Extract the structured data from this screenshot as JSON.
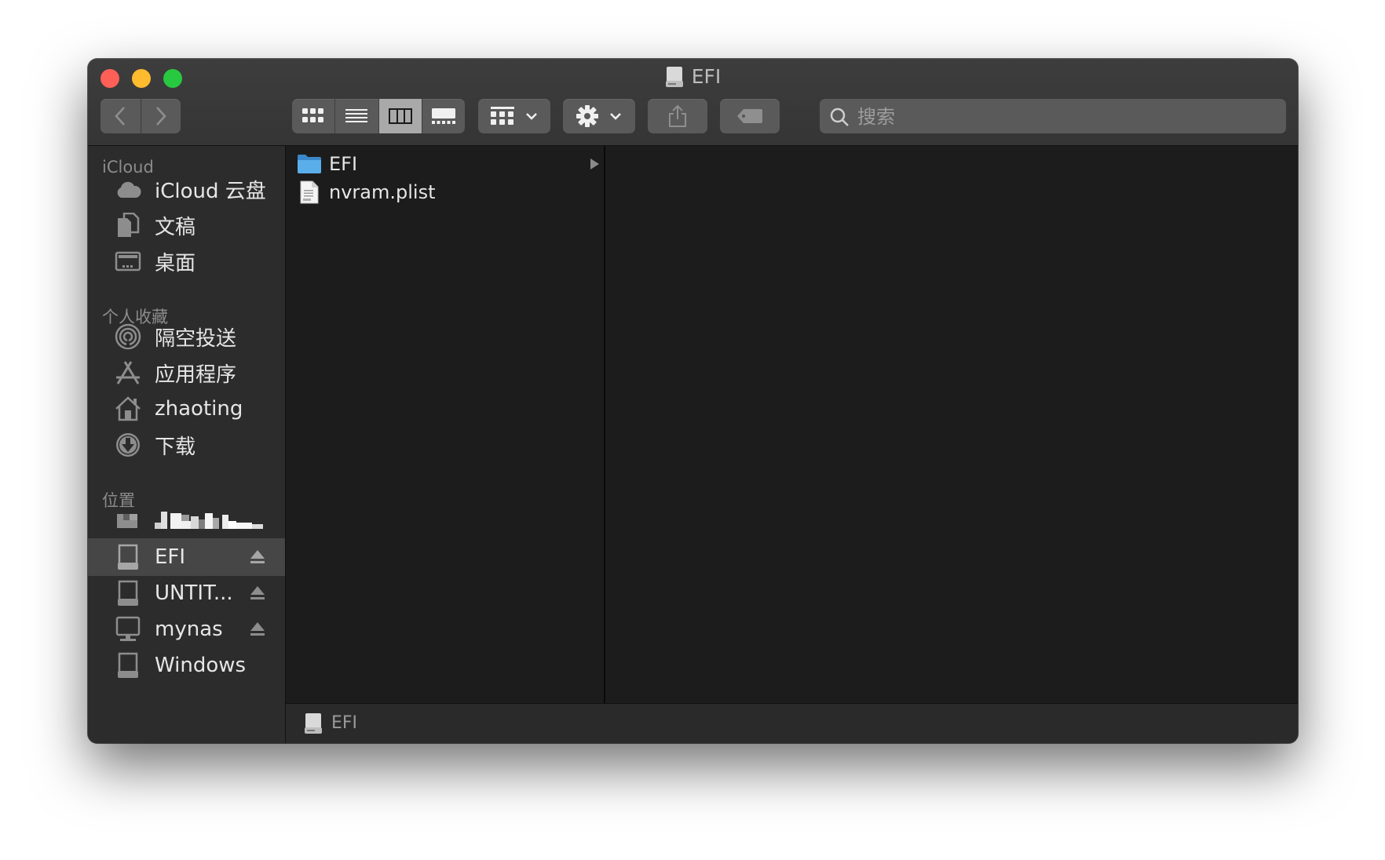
{
  "window": {
    "title": "EFI"
  },
  "toolbar": {
    "search_placeholder": "搜索",
    "active_view": "column"
  },
  "sidebar": {
    "sections": [
      {
        "header": "iCloud",
        "items": [
          {
            "label": "iCloud 云盘",
            "icon": "cloud-icon"
          },
          {
            "label": "文稿",
            "icon": "document-icon"
          },
          {
            "label": "桌面",
            "icon": "desktop-icon"
          }
        ]
      },
      {
        "header": "个人收藏",
        "items": [
          {
            "label": "隔空投送",
            "icon": "airdrop-icon"
          },
          {
            "label": "应用程序",
            "icon": "applications-icon"
          },
          {
            "label": "zhaoting",
            "icon": "home-icon"
          },
          {
            "label": "下载",
            "icon": "download-icon"
          }
        ]
      },
      {
        "header": "位置",
        "items": [
          {
            "label": "",
            "icon": "computer-icon",
            "redacted": true
          },
          {
            "label": "EFI",
            "icon": "drive-icon",
            "eject": true,
            "selected": true
          },
          {
            "label": "UNTIT...",
            "icon": "drive-icon",
            "eject": true
          },
          {
            "label": "mynas",
            "icon": "network-drive-icon",
            "eject": true
          },
          {
            "label": "Windows",
            "icon": "drive-icon"
          }
        ]
      }
    ]
  },
  "files": [
    {
      "name": "EFI",
      "type": "folder",
      "icon": "folder-icon"
    },
    {
      "name": "nvram.plist",
      "type": "file",
      "icon": "plist-file-icon"
    }
  ],
  "pathbar": {
    "label": "EFI"
  },
  "colors": {
    "close": "#fe5f57",
    "minimize": "#febc2e",
    "maximize": "#28c840",
    "folder": "#4a9fe0",
    "selection": "#464646"
  }
}
